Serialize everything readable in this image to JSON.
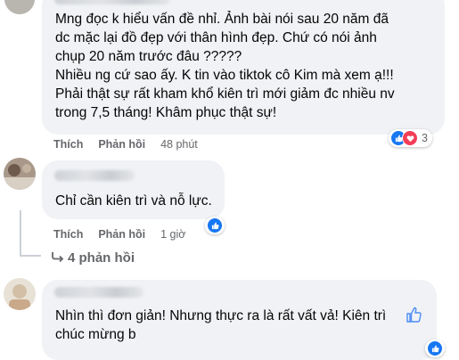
{
  "comments": [
    {
      "lines": [
        "Mng đọc k hiểu vấn đề nhỉ. Ảnh bài nói sau 20 năm đã",
        "dc mặc lại đồ đẹp với thân hình đẹp. Chứ có nói ảnh",
        "chụp 20 năm trước đâu ?????",
        "Nhiều ng cứ sao ấy. K tin vào tiktok cô Kim mà xem ạ!!!",
        "Phải thật sự rất kham khổ kiên trì mới giảm đc nhiều nv",
        "trong 7,5 tháng! Khâm phục thật sự!"
      ],
      "like_label": "Thích",
      "reply_label": "Phản hồi",
      "time": "48 phút",
      "reaction_count": "3",
      "reactions": [
        "like-icon",
        "love-icon"
      ]
    },
    {
      "lines": [
        "Chỉ cần kiên trì và nỗ lực."
      ],
      "like_label": "Thích",
      "reply_label": "Phản hồi",
      "time": "1 giờ",
      "reactions": [
        "like-icon"
      ]
    },
    {
      "lines": [
        "Nhìn thì đơn giản! Nhưng thực ra là rất vất vả! Kiên trì",
        "chúc mừng b"
      ],
      "reactions": [
        "like-icon"
      ]
    }
  ],
  "replies_link": "4 phản hồi",
  "separator": "·",
  "colors": {
    "bubble": "#f0f2f5",
    "meta": "#65676b",
    "like_blue": "#1877f2",
    "love_red": "#f33e58"
  }
}
